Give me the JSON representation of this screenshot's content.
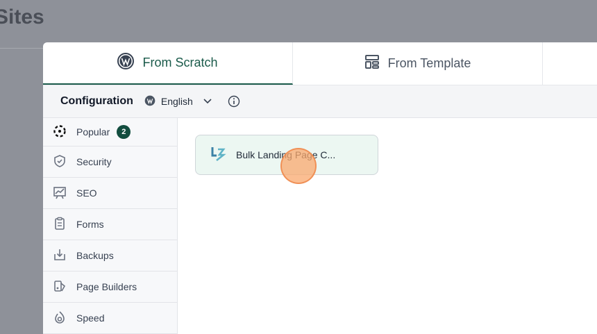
{
  "page": {
    "title": "Sites"
  },
  "tabs": [
    {
      "label": "From Scratch",
      "icon": "wordpress-icon",
      "active": true
    },
    {
      "label": "From Template",
      "icon": "template-icon",
      "active": false
    }
  ],
  "config": {
    "label": "Configuration",
    "language": "English"
  },
  "sidebar": {
    "items": [
      {
        "label": "Popular",
        "icon": "popular-icon",
        "badge": "2"
      },
      {
        "label": "Security",
        "icon": "shield-icon"
      },
      {
        "label": "SEO",
        "icon": "seo-chart-icon"
      },
      {
        "label": "Forms",
        "icon": "clipboard-icon"
      },
      {
        "label": "Backups",
        "icon": "backup-download-icon"
      },
      {
        "label": "Page Builders",
        "icon": "page-builder-icon"
      },
      {
        "label": "Speed",
        "icon": "speed-icon"
      }
    ]
  },
  "plugins": [
    {
      "name": "Bulk Landing Page C...",
      "icon": "bulk-landing-logo-icon"
    }
  ],
  "colors": {
    "accent": "#1a5a4a",
    "badge": "#124d3f",
    "card_bg": "#ecf7f2"
  }
}
